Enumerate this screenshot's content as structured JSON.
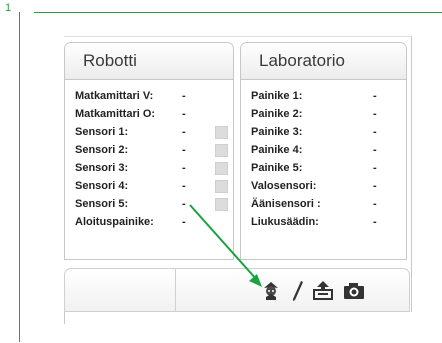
{
  "step": {
    "number": "1"
  },
  "robot_panel": {
    "title": "Robotti",
    "rows": [
      {
        "label": "Matkamittari V:",
        "value": "-",
        "has_indicator": false
      },
      {
        "label": "Matkamittari O:",
        "value": "-",
        "has_indicator": false
      },
      {
        "label": "Sensori 1:",
        "value": "-",
        "has_indicator": true
      },
      {
        "label": "Sensori 2:",
        "value": "-",
        "has_indicator": true
      },
      {
        "label": "Sensori 3:",
        "value": "-",
        "has_indicator": true
      },
      {
        "label": "Sensori 4:",
        "value": "-",
        "has_indicator": true
      },
      {
        "label": "Sensori 5:",
        "value": "-",
        "has_indicator": true
      },
      {
        "label": "Aloituspainike:",
        "value": "-",
        "has_indicator": false
      }
    ]
  },
  "lab_panel": {
    "title": "Laboratorio",
    "rows": [
      {
        "label": "Painike 1:",
        "value": "-"
      },
      {
        "label": "Painike 2:",
        "value": "-"
      },
      {
        "label": "Painike 3:",
        "value": "-"
      },
      {
        "label": "Painike 4:",
        "value": "-"
      },
      {
        "label": "Painike 5:",
        "value": "-"
      },
      {
        "label": "Valosensori:",
        "value": "-"
      },
      {
        "label": "Äänisensori :",
        "value": "-"
      },
      {
        "label": "Liukusäädin:",
        "value": "-"
      }
    ]
  },
  "toolbar": {
    "icons": [
      "sprite-icon",
      "pencil-icon",
      "upload-icon",
      "camera-icon"
    ]
  },
  "colors": {
    "step_accent": "#2b9b3f",
    "arrow": "#1aa33f",
    "indicator": "#dcdcdc"
  }
}
